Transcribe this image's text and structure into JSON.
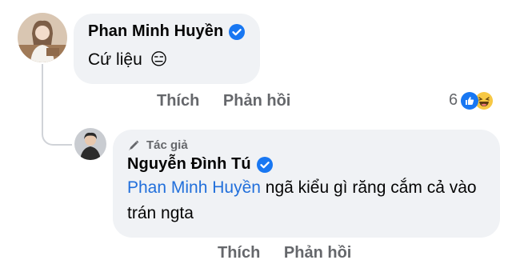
{
  "comment1": {
    "author": "Phan Minh Huyền",
    "text": "Cứ liệu",
    "emoji": "😑",
    "actions": {
      "like": "Thích",
      "reply": "Phản hồi"
    },
    "reaction_count": "6"
  },
  "reply1": {
    "author_badge": "Tác giả",
    "author": "Nguyễn Đình Tú",
    "mention": "Phan Minh Huyền",
    "text": " ngã kiểu gì răng cắm cả vào trán ngta",
    "actions": {
      "like": "Thích",
      "reply": "Phản hồi"
    }
  },
  "colors": {
    "bubble": "#f0f2f5",
    "verified": "#1877f2",
    "mention": "#216fdb",
    "muted": "#65676b"
  }
}
